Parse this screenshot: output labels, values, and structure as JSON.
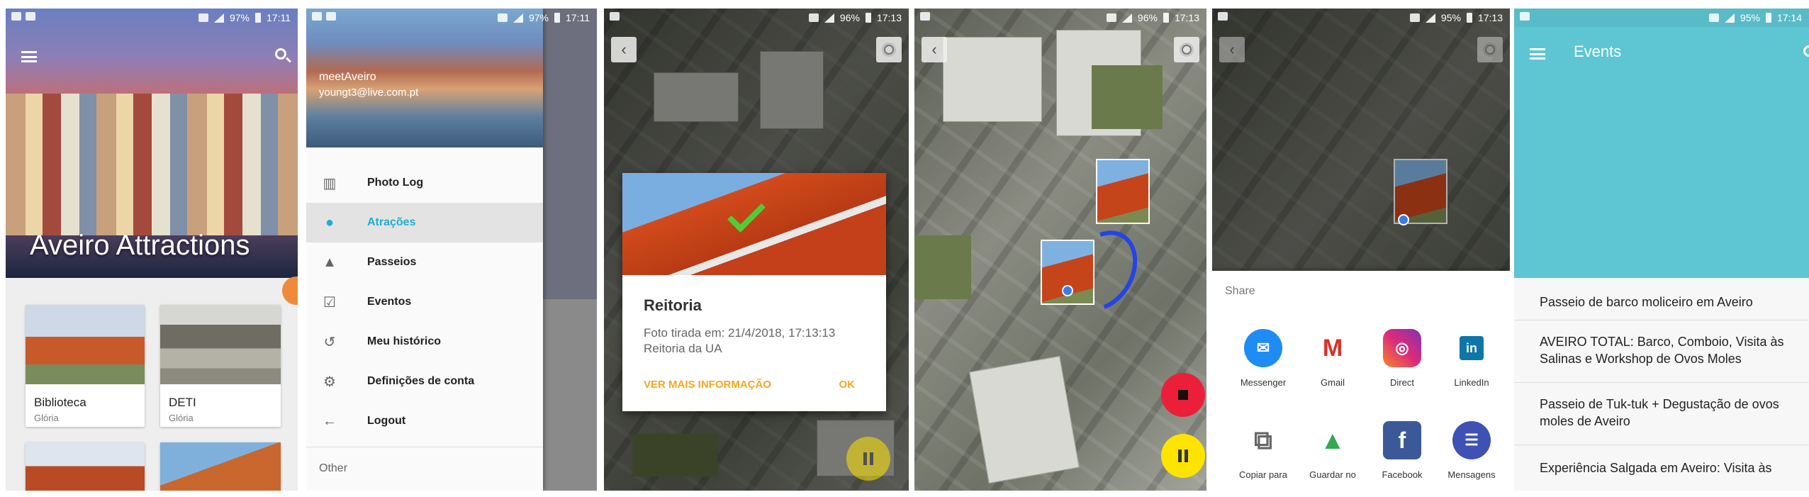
{
  "screens": {
    "attractions": {
      "status": {
        "battery": "97%",
        "time": "17:11"
      },
      "title": "Aveiro Attractions",
      "cards": [
        {
          "name": "Biblioteca",
          "sub": "Glória"
        },
        {
          "name": "DETI",
          "sub": "Glória"
        }
      ]
    },
    "drawer": {
      "status": {
        "battery": "97%",
        "time": "17:11"
      },
      "user_name": "meetAveiro",
      "user_email": "youngt3@live.com.pt",
      "items": [
        {
          "label": "Photo Log",
          "icon": "map-icon"
        },
        {
          "label": "Atrações",
          "icon": "location-pin-icon"
        },
        {
          "label": "Passeios",
          "icon": "navigation-arrow-icon"
        },
        {
          "label": "Eventos",
          "icon": "calendar-check-icon"
        },
        {
          "label": "Meu histórico",
          "icon": "history-icon"
        },
        {
          "label": "Definições de conta",
          "icon": "gear-icon"
        },
        {
          "label": "Logout",
          "icon": "arrow-left-icon"
        }
      ],
      "other_label": "Other"
    },
    "photo_dialog": {
      "status": {
        "battery": "96%",
        "time": "17:13"
      },
      "title": "Reitoria",
      "line1": "Foto tirada em: 21/4/2018, 17:13:13",
      "line2": "Reitoria da UA",
      "more_button": "VER MAIS INFORMAÇÃO",
      "ok_button": "OK"
    },
    "route_map": {
      "status": {
        "battery": "96%",
        "time": "17:13"
      }
    },
    "share_sheet": {
      "status": {
        "battery": "95%",
        "time": "17:13"
      },
      "title": "Share",
      "apps": [
        {
          "label": "Messenger",
          "color": "#1f8bf5"
        },
        {
          "label": "Gmail",
          "color": "#ffffff"
        },
        {
          "label": "Direct",
          "color": "#c6338a"
        },
        {
          "label": "LinkedIn",
          "color": "#ffffff"
        },
        {
          "label": "Copiar para",
          "color": "#ffffff"
        },
        {
          "label": "Guardar no",
          "color": "#ffffff"
        },
        {
          "label": "Facebook",
          "color": "#3b5998"
        },
        {
          "label": "Mensagens",
          "color": "#3f51b5"
        }
      ]
    },
    "events": {
      "status": {
        "battery": "95%",
        "time": "17:14"
      },
      "title": "Events",
      "items": [
        "Passeio de barco moliceiro em Aveiro",
        "AVEIRO TOTAL: Barco, Comboio, Visita às Salinas e Workshop de Ovos Moles",
        "Passeio de Tuk-tuk + Degustação de ovos moles de Aveiro",
        "Experiência Salgada em Aveiro: Visita às"
      ]
    }
  },
  "colors": {
    "accent": "#1eaed0",
    "events_header": "#5ec6d3",
    "dialog_button": "#f5a623",
    "pause_fab": "#ffe400",
    "stop_fab": "#ec1f3a"
  }
}
